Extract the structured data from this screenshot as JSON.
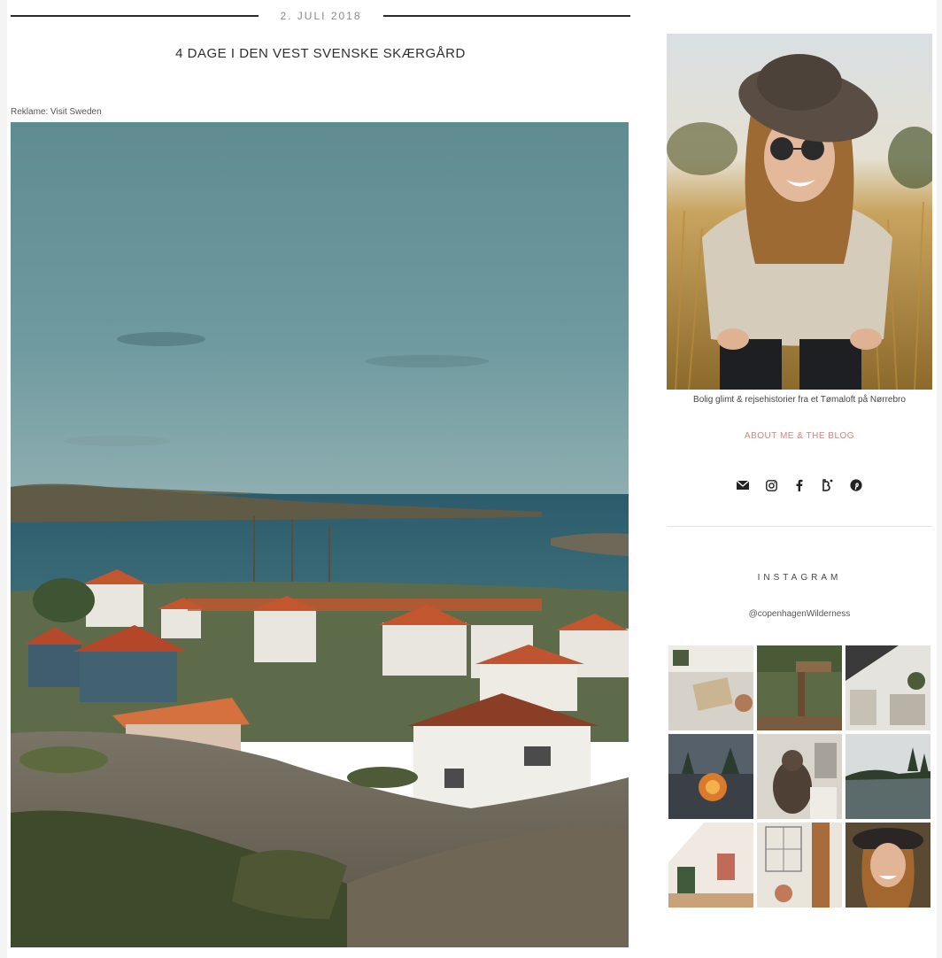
{
  "post": {
    "date": "2. JULI 2018",
    "title": "4 DAGE I DEN VEST SVENSKE SKÆRGÅRD",
    "sponsor": "Reklame: Visit Sweden"
  },
  "sidebar": {
    "caption": "Bolig glimt & rejsehistorier fra et Tømaloft på Nørrebro",
    "about_link": "ABOUT ME & THE BLOG",
    "social_icons": [
      "mail-icon",
      "instagram-icon",
      "facebook-icon",
      "bloglovin-icon",
      "pinterest-icon"
    ],
    "instagram": {
      "heading": "INSTAGRAM",
      "handle": "@copenhagenWilderness"
    }
  },
  "colors": {
    "accent_link": "#c9868a",
    "date_rule": "#2a2a2a"
  }
}
